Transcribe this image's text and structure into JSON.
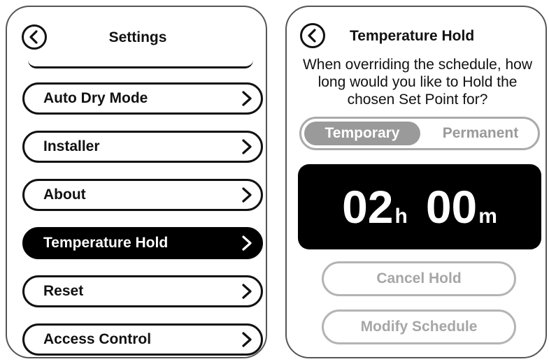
{
  "settings": {
    "title": "Settings",
    "menu_items": [
      {
        "label": "Auto Dry Mode"
      },
      {
        "label": "Installer"
      },
      {
        "label": "About"
      },
      {
        "label": "Temperature Hold"
      },
      {
        "label": "Reset"
      },
      {
        "label": "Access Control"
      }
    ],
    "active_item": "Temperature Hold"
  },
  "temperature_hold": {
    "title": "Temperature Hold",
    "prompt": "When overriding the schedule, how long would you like to Hold the chosen Set Point for?",
    "mode_options": [
      "Temporary",
      "Permanent"
    ],
    "selected_mode": "Temporary",
    "timer": {
      "hours": "02",
      "hours_unit": "h",
      "minutes": "00",
      "minutes_unit": "m"
    },
    "cancel_label": "Cancel Hold",
    "modify_label": "Modify Schedule"
  },
  "icons": {
    "back": "back-arrow-icon",
    "chevron": "chevron-right-icon"
  },
  "colors": {
    "active_bg": "#000000",
    "disabled_text": "#a6a6a6",
    "selected_segment": "#9a9a9a"
  }
}
